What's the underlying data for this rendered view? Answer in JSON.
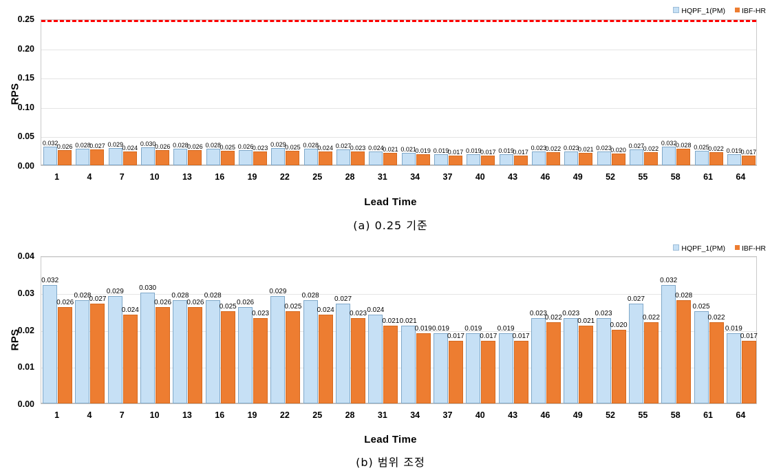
{
  "figure": {
    "panels": [
      {
        "caption": "(a)  0.25 기준",
        "chart_data": {
          "type": "bar",
          "title": "",
          "xlabel": "Lead Time",
          "ylabel": "RPS",
          "categories": [
            "1",
            "4",
            "7",
            "10",
            "13",
            "16",
            "19",
            "22",
            "25",
            "28",
            "31",
            "34",
            "37",
            "40",
            "43",
            "46",
            "49",
            "52",
            "55",
            "58",
            "61",
            "64"
          ],
          "series": [
            {
              "name": "HQPF_1(PM)",
              "color": "#c6e0f5",
              "values": [
                0.032,
                0.028,
                0.029,
                0.03,
                0.028,
                0.028,
                0.026,
                0.029,
                0.028,
                0.027,
                0.024,
                0.021,
                0.019,
                0.019,
                0.019,
                0.023,
                0.023,
                0.023,
                0.027,
                0.032,
                0.025,
                0.019
              ]
            },
            {
              "name": "IBF-HR",
              "color": "#ed7d31",
              "values": [
                0.026,
                0.027,
                0.024,
                0.026,
                0.026,
                0.025,
                0.023,
                0.025,
                0.024,
                0.023,
                0.021,
                0.019,
                0.017,
                0.017,
                0.017,
                0.022,
                0.021,
                0.02,
                0.022,
                0.028,
                0.022,
                0.017
              ]
            }
          ],
          "yticks": [
            "0.00",
            "0.05",
            "0.10",
            "0.15",
            "0.20",
            "0.25"
          ],
          "ylim": [
            0,
            0.25
          ],
          "grid": true,
          "legend_position": "top-right",
          "annotations": [
            {
              "type": "threshold-line",
              "value": 0.25,
              "color": "#ff0000",
              "style": "dashed"
            }
          ]
        }
      },
      {
        "caption": "(b)  범위 조정",
        "chart_data": {
          "type": "bar",
          "title": "",
          "xlabel": "Lead Time",
          "ylabel": "RPS",
          "categories": [
            "1",
            "4",
            "7",
            "10",
            "13",
            "16",
            "19",
            "22",
            "25",
            "28",
            "31",
            "34",
            "37",
            "40",
            "43",
            "46",
            "49",
            "52",
            "55",
            "58",
            "61",
            "64"
          ],
          "series": [
            {
              "name": "HQPF_1(PM)",
              "color": "#c6e0f5",
              "values": [
                0.032,
                0.028,
                0.029,
                0.03,
                0.028,
                0.028,
                0.026,
                0.029,
                0.028,
                0.027,
                0.024,
                0.021,
                0.019,
                0.019,
                0.019,
                0.023,
                0.023,
                0.023,
                0.027,
                0.032,
                0.025,
                0.019
              ]
            },
            {
              "name": "IBF-HR",
              "color": "#ed7d31",
              "values": [
                0.026,
                0.027,
                0.024,
                0.026,
                0.026,
                0.025,
                0.023,
                0.025,
                0.024,
                0.023,
                0.021,
                0.019,
                0.017,
                0.017,
                0.017,
                0.022,
                0.021,
                0.02,
                0.022,
                0.028,
                0.022,
                0.017
              ]
            }
          ],
          "yticks": [
            "0.00",
            "0.01",
            "0.02",
            "0.03",
            "0.04"
          ],
          "ylim": [
            0,
            0.04
          ],
          "grid": true,
          "legend_position": "top-right",
          "annotations": []
        }
      }
    ]
  }
}
